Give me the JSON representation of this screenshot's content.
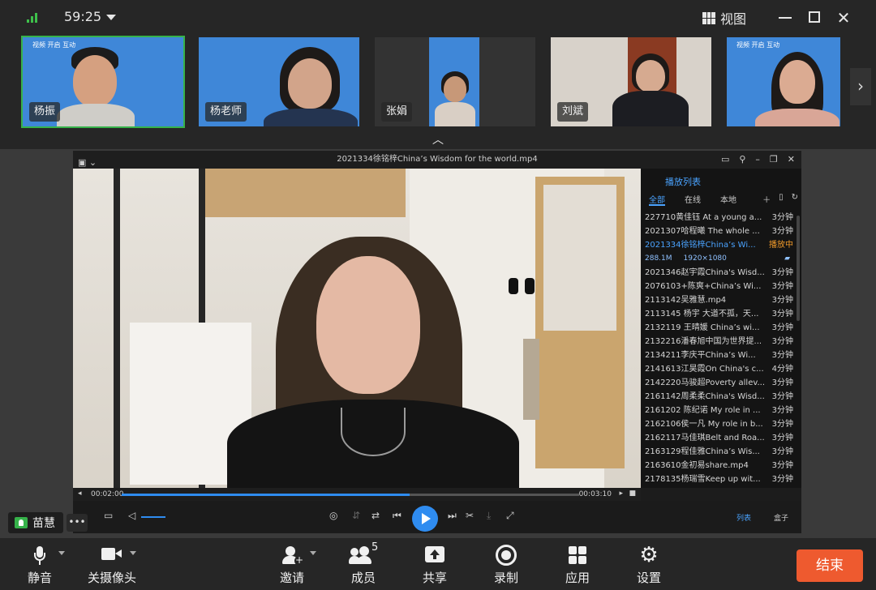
{
  "titlebar": {
    "timer": "59:25",
    "view_label": "视图"
  },
  "participants": [
    {
      "name": "杨振",
      "active": true,
      "banner": "视频 开启 互动"
    },
    {
      "name": "杨老师",
      "active": false,
      "banner": ""
    },
    {
      "name": "张娟",
      "active": false,
      "banner": ""
    },
    {
      "name": "刘斌",
      "active": false,
      "banner": ""
    },
    {
      "name": "",
      "active": false,
      "banner": "视频 开启 互动"
    }
  ],
  "player": {
    "title": "2021334徐铭梓China’s Wisdom for the world.mp4",
    "elapsed": "00:02:00",
    "total": "00:03:10",
    "progress": 0.63,
    "list_pill": "列表",
    "box_pill": "盒子"
  },
  "playlist": {
    "header": "播放列表",
    "tabs": [
      "全部",
      "在线",
      "本地"
    ],
    "items": [
      {
        "title": "227710黄佳钰 At a young a...",
        "duration": "3分钟"
      },
      {
        "title": "2021307哈程曦 The whole ...",
        "duration": "3分钟"
      },
      {
        "title": "2021334徐铭梓China’s Wi...",
        "duration": "播放中",
        "playing": true
      },
      {
        "title": "2021346赵宇霞China's Wisd...",
        "duration": "3分钟"
      },
      {
        "title": "2076103+陈爽+China’s Wi...",
        "duration": "3分钟"
      },
      {
        "title": "2113142吴雅慧.mp4",
        "duration": "3分钟"
      },
      {
        "title": "2113145 杨宇 大道不孤，天...",
        "duration": "3分钟"
      },
      {
        "title": "2132119 王晴媛 China’s wi...",
        "duration": "3分钟"
      },
      {
        "title": "2132216潘春旭中国为世界提...",
        "duration": "3分钟"
      },
      {
        "title": "2134211李庆平China’s Wi...",
        "duration": "3分钟"
      },
      {
        "title": "2141613江昊霞On China's c...",
        "duration": "4分钟"
      },
      {
        "title": "2142220马骏超Poverty allev...",
        "duration": "3分钟"
      },
      {
        "title": "2161142周柔柔China's Wisd...",
        "duration": "3分钟"
      },
      {
        "title": "2161202 陈纪诺 My role in ...",
        "duration": "3分钟"
      },
      {
        "title": "2162106侯一凡 My role in b...",
        "duration": "3分钟"
      },
      {
        "title": "2162117马佳琪Belt and Roa...",
        "duration": "3分钟"
      },
      {
        "title": "2163129程佳雅China’s Wis...",
        "duration": "3分钟"
      },
      {
        "title": "2163610金初易share.mp4",
        "duration": "3分钟"
      },
      {
        "title": "2178135杨瑞雪Keep up wit...",
        "duration": "3分钟"
      }
    ],
    "meta_size": "288.1M",
    "meta_res": "1920×1080"
  },
  "speaker": {
    "name": "苗慧"
  },
  "toolbar": {
    "mute": "静音",
    "camera": "关摄像头",
    "invite": "邀请",
    "members": "成员",
    "members_count": "5",
    "share": "共享",
    "record": "录制",
    "apps": "应用",
    "settings": "设置",
    "end": "结束"
  },
  "colors": {
    "accent": "#2f8cf0",
    "end": "#ee5a2f",
    "active_green": "#36b24a"
  }
}
